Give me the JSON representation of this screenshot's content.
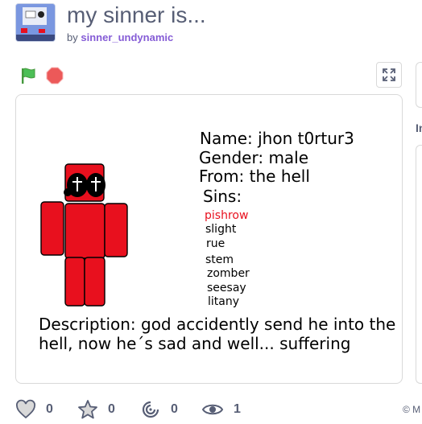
{
  "project": {
    "title": "my sinner is...",
    "by_label": "by",
    "author": "sinner_undynamic"
  },
  "stage": {
    "name_line": "Name: jhon t0rtur3",
    "gender_line": "Gender: male",
    "from_line": "From: the hell",
    "sins_label": "Sins:",
    "sins": [
      "pishrow",
      "slight",
      "rue",
      "stem",
      "zomber",
      "seesay",
      "litany"
    ],
    "highlighted_sin_color": "#e8101e",
    "description_line1": "Description: god accidently send he into the",
    "description_line2": "hell, now he´s sad and well... suffering"
  },
  "stats": {
    "loves": "0",
    "favorites": "0",
    "remixes": "0",
    "views": "1"
  },
  "side": {
    "label": "In",
    "footer": "© M"
  },
  "colors": {
    "green_flag": "#4cbf56",
    "stop": "#ec5959",
    "character": "#e8101e"
  }
}
